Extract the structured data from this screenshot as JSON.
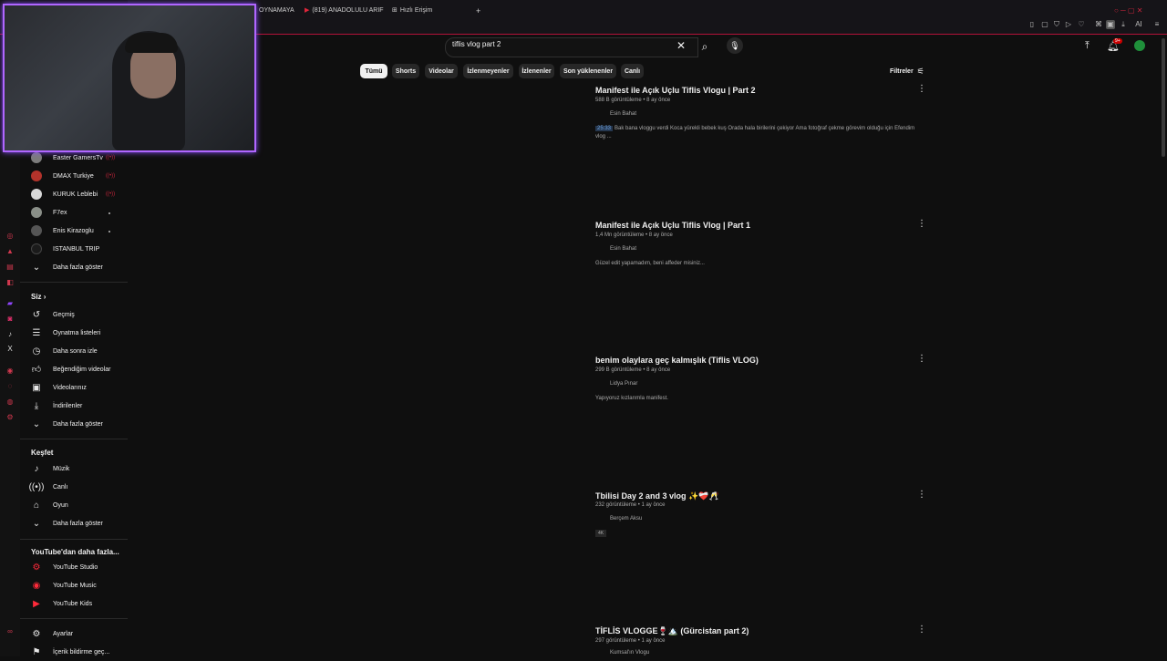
{
  "browser": {
    "tabs": [
      {
        "label": "OYNAMAYA"
      },
      {
        "label": "(819) ANADOLULU ARIF"
      },
      {
        "label": "Hızlı Erişim"
      }
    ],
    "new_tab": "+"
  },
  "search": {
    "query": "tiflis vlog part 2"
  },
  "header": {
    "notifications_badge": "9+"
  },
  "chips": [
    "Tümü",
    "Shorts",
    "Videolar",
    "İzlenmeyenler",
    "İzlenenler",
    "Son yüklenenler",
    "Canlı"
  ],
  "filters_label": "Filtreler",
  "subscriptions": [
    {
      "name": "Easter GamersTv",
      "status": "live",
      "live_text": "((•))"
    },
    {
      "name": "DMAX Turkiye",
      "status": "live",
      "live_text": "((•))"
    },
    {
      "name": "KURUK Leblebi",
      "status": "live",
      "live_text": "((•))"
    },
    {
      "name": "F7ex",
      "status": "dot"
    },
    {
      "name": "Enis Kirazoglu",
      "status": "dot"
    },
    {
      "name": "ISTANBUL TRIP",
      "status": "none"
    }
  ],
  "sidebar": {
    "show_more": "Daha fazla göster",
    "you_header": "Siz",
    "you_items": [
      "Geçmiş",
      "Oynatma listeleri",
      "Daha sonra izle",
      "Beğendiğim videolar",
      "Videolarınız",
      "İndirilenler",
      "Daha fazla göster"
    ],
    "explore_header": "Keşfet",
    "explore_items": [
      "Müzik",
      "Canlı",
      "Oyun",
      "Daha fazla göster"
    ],
    "more_header": "YouTube'dan daha fazla...",
    "more_items": [
      "YouTube Studio",
      "YouTube Music",
      "YouTube Kids"
    ],
    "settings": "Ayarlar",
    "report_history": "İçerik bildirme geç..."
  },
  "results": [
    {
      "title": "Manifest ile Açık Uçlu Tiflis Vlogu | Part 2",
      "meta": "588 B görüntüleme • 8 ay önce",
      "channel": "Esin Bahat",
      "timestamp": "25:33",
      "desc": "Bak bana vloggu verdi Koca yürekli bebek kuş Orada hala birilerini çekiyor Ama fotoğraf çekme görevim olduğu için Efendim vlog ..."
    },
    {
      "title": "Manifest ile Açık Uçlu Tiflis Vlog | Part 1",
      "meta": "1,4 Mn görüntüleme • 8 ay önce",
      "channel": "Esin Bahat",
      "desc": "Güzel edit yapamadım, beni affeder misiniz..."
    },
    {
      "title": "benim olaylara geç kalmışlık (Tiflis VLOG)",
      "meta": "299 B görüntüleme • 8 ay önce",
      "channel": "Lidya Pınar",
      "desc": "Yapıyoruz kızlarımla manifest."
    },
    {
      "title": "Tbilisi Day 2 and 3 vlog ✨❤️‍🩹🥂",
      "meta": "232 görüntüleme • 1 ay önce",
      "channel": "Berçem Aksu",
      "badge": "4K"
    },
    {
      "title": "TİFLİS VLOGGE🍷🏔️ (Gürcistan part 2)",
      "meta": "297 görüntüleme • 1 ay önce",
      "channel": "Kumsal'ın Vlogu"
    }
  ]
}
